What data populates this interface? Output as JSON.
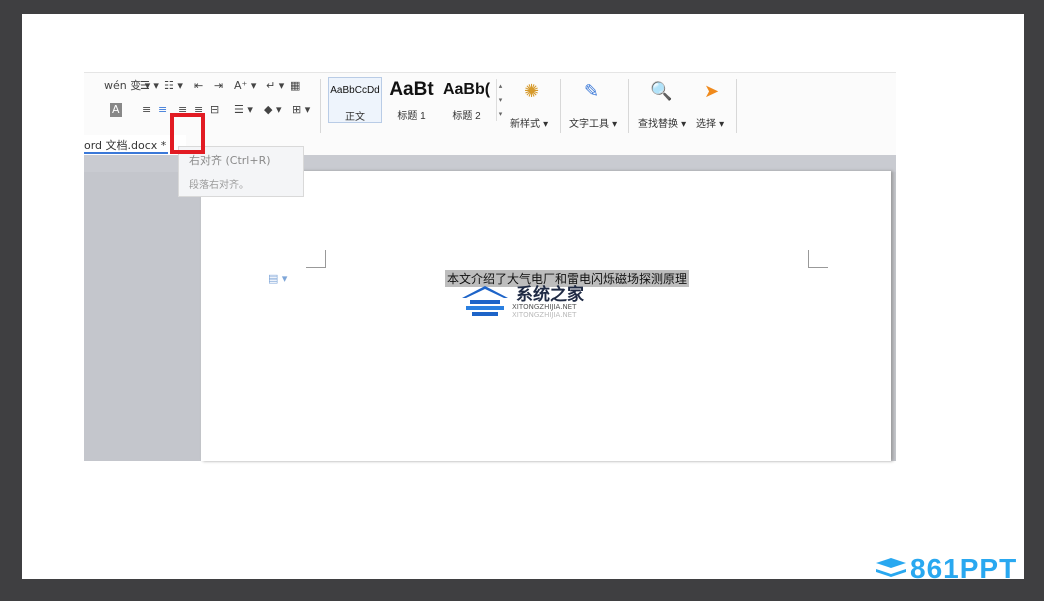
{
  "ribbon": {
    "row1": [
      "wén 变 ▾",
      "☰ ▾",
      "☷ ▾",
      "⇤",
      "⇥",
      "A⁺ ▾",
      "↵ ▾",
      "▦"
    ],
    "row2": [
      "A",
      "≡",
      "≡",
      "≡",
      "≡",
      "⊟",
      "☰ ▾",
      "◆ ▾",
      "⊞ ▾"
    ],
    "styles": [
      {
        "preview": "AaBbCcDd",
        "label": "正文"
      },
      {
        "preview": "AaBt",
        "label": "标题 1"
      },
      {
        "preview": "AaBb(",
        "label": "标题 2"
      }
    ],
    "new_style_label": "新样式 ▾",
    "text_tool_label": "文字工具 ▾",
    "find_replace_label": "查找替换 ▾",
    "select_label": "选择 ▾"
  },
  "tab": {
    "label": "ord 文档.docx *"
  },
  "tooltip": {
    "title": "右对齐 (Ctrl+R)",
    "desc": "段落右对齐。"
  },
  "document": {
    "text": "本文介绍了大气电厂和雷电闪烁磁场探测原理"
  },
  "watermark": {
    "name": "系统之家",
    "url": "XITONGZHIJIA.NET",
    "url2": "XITONGZHIJIA.NET"
  },
  "brand": {
    "label": "861PPT"
  },
  "colors": {
    "highlight": "#e21b23",
    "brand": "#29a8f0",
    "selection": "#bdbdbd"
  }
}
